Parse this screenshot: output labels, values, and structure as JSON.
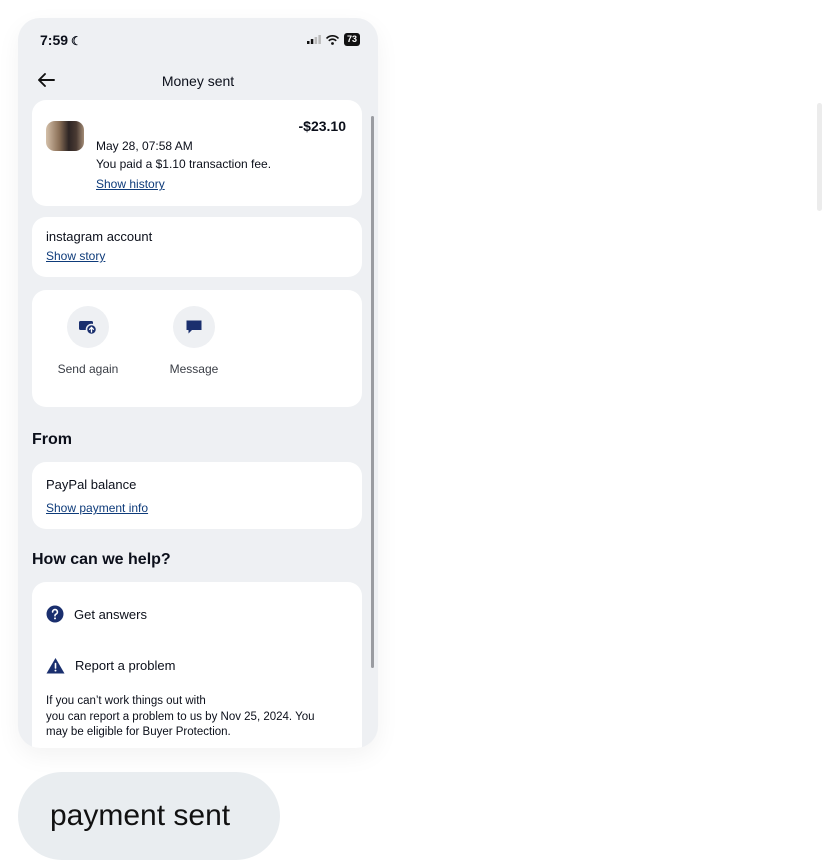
{
  "status_bar": {
    "time": "7:59",
    "battery": "73"
  },
  "nav": {
    "title": "Money sent"
  },
  "transaction": {
    "amount": "-$23.10",
    "date": "May 28, 07:58 AM",
    "fee_note": "You paid a $1.10 transaction fee.",
    "history_link": "Show history"
  },
  "note": {
    "text": "instagram account",
    "story_link": "Show story"
  },
  "actions": [
    {
      "label": "Send again",
      "icon": "send-again-icon"
    },
    {
      "label": "Message",
      "icon": "message-icon"
    }
  ],
  "from": {
    "heading": "From",
    "source": "PayPal balance",
    "info_link": "Show payment info"
  },
  "help": {
    "heading": "How can we help?",
    "items": [
      {
        "label": "Get answers",
        "icon": "question-icon"
      },
      {
        "label": "Report a problem",
        "icon": "warning-icon"
      }
    ],
    "disclaimer_lines": [
      "If you can’t work things out with",
      "you can report a problem to us by Nov 25, 2024. You",
      "may be eligible for Buyer Protection."
    ]
  },
  "caption": {
    "text": "payment sent"
  },
  "colors": {
    "accent": "#0e3b7a",
    "icon_dark": "#1a2f6e",
    "screen_bg": "#eef0f3"
  }
}
